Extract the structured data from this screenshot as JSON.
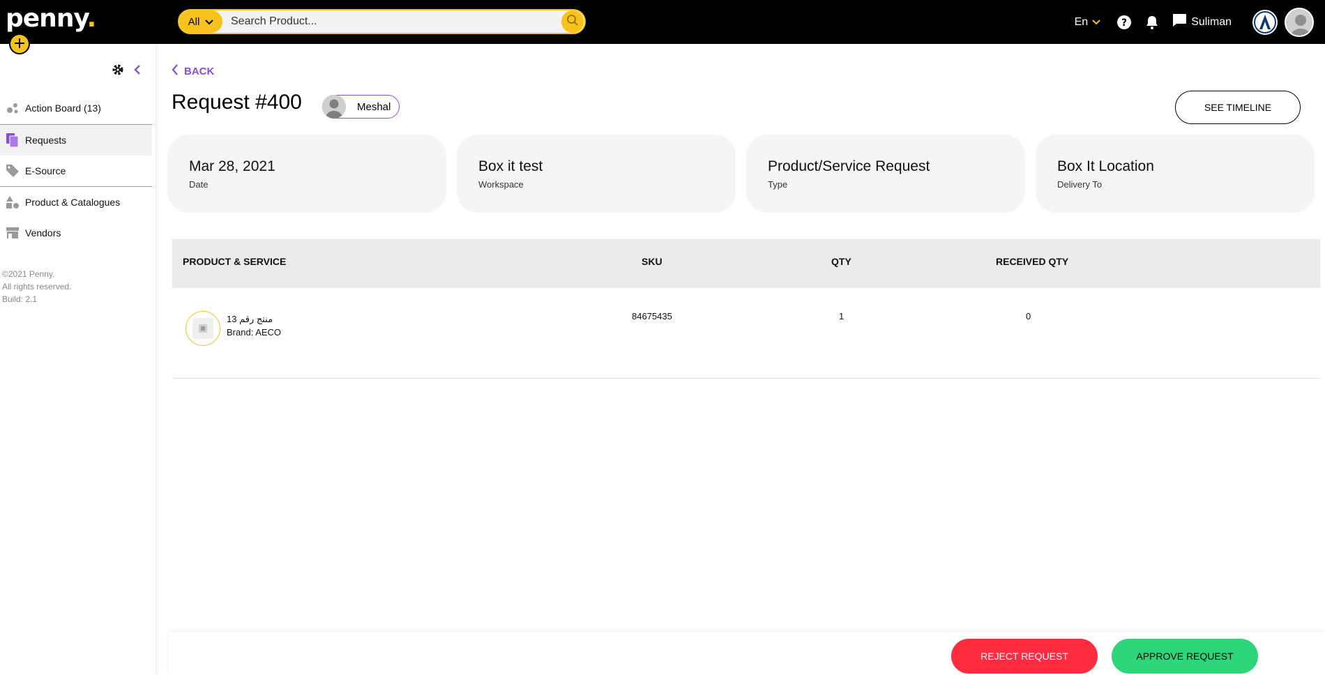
{
  "app": {
    "logo_text": "penny",
    "logo_dot": "."
  },
  "colors": {
    "accent": "#f7c31b",
    "purple": "#8a4ddb",
    "reject": "#ff2b3f",
    "approve": "#2ed67a",
    "topbar": "#000000"
  },
  "topbar": {
    "search_category": "All",
    "search_placeholder": "Search Product...",
    "language": "En",
    "user_name": "Suliman",
    "icons": [
      "help-icon",
      "bell-icon",
      "chat-icon",
      "brand-logo",
      "avatar"
    ]
  },
  "sidebar": {
    "items": [
      {
        "label": "Action Board (13)",
        "icon": "action-board-icon"
      },
      {
        "label": "Requests",
        "icon": "requests-icon",
        "active": true
      },
      {
        "label": "E-Source",
        "icon": "tag-icon"
      },
      {
        "label": "Product & Catalogues",
        "icon": "shapes-icon"
      },
      {
        "label": "Vendors",
        "icon": "store-icon"
      }
    ],
    "footer": [
      "©2021 Penny.",
      "All rights reserved.",
      "Build: 2.1"
    ]
  },
  "main": {
    "back_label": "BACK",
    "title": "Request #400",
    "requester": "Meshal",
    "timeline_label": "SEE TIMELINE",
    "cards": [
      {
        "value": "Mar 28, 2021",
        "label": "Date"
      },
      {
        "value": "Box it test",
        "label": "Workspace"
      },
      {
        "value": "Product/Service Request",
        "label": "Type"
      },
      {
        "value": "Box It Location",
        "label": "Delivery To"
      }
    ],
    "table": {
      "headers": [
        "PRODUCT & SERVICE",
        "SKU",
        "QTY",
        "RECEIVED QTY"
      ],
      "rows": [
        {
          "name": "منتج رقم 13",
          "brand": "Brand: AECO",
          "sku": "84675435",
          "qty": "1",
          "received": "0"
        }
      ]
    },
    "actions": {
      "reject": "REJECT REQUEST",
      "approve": "APPROVE REQUEST"
    }
  }
}
